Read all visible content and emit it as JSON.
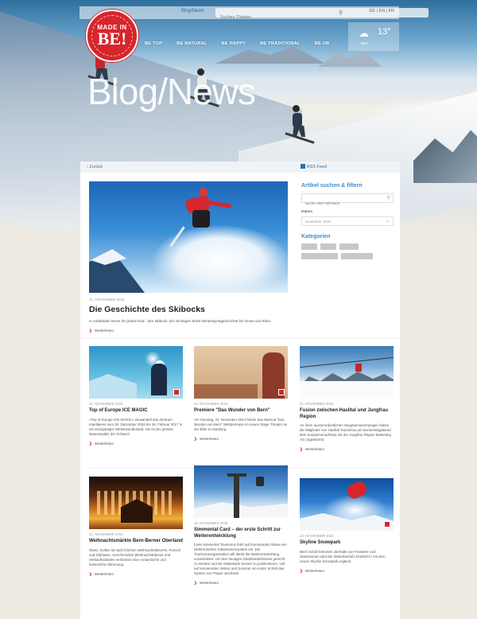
{
  "colors": {
    "accent": "#d7252c",
    "link": "#3d8ed1",
    "page_bg": "#eeeae1"
  },
  "topbar": {
    "blog_link": "Blog/News",
    "search_placeholder": "Suchen Theater",
    "lang": "DE | EN | FR"
  },
  "logo": {
    "made": "MADE IN",
    "be": "BE!"
  },
  "nav": {
    "items": [
      "BE TOP",
      "BE NATURAL",
      "BE HAPPY",
      "BE TRADITIONAL",
      "BE UB"
    ]
  },
  "weather": {
    "icon": "cloud-icon",
    "temp": "13°",
    "label": "Bern"
  },
  "hero": {
    "title": "Blog/News"
  },
  "crumbbar": {
    "back": "‹ Zurück",
    "rss": "RSS Feed"
  },
  "featured": {
    "date": "21. NOVEMBER 2016",
    "title": "Die Geschichte des Skibocks",
    "excerpt": "In Adelboden kennt ihn jedes Kind - den Skibock. Ein wichtiges Stück Wintersportgeschichte für Gross und Klein.",
    "more": "Weiterlesen"
  },
  "sidebar": {
    "filter_title": "Artikel suchen & filtern",
    "search_placeholder": "Suche nach Stichwort",
    "date_label": "Datum",
    "date_value": "November 2016",
    "categories_title": "Kategorien"
  },
  "cards": [
    {
      "date": "22. NOVEMBER 2016",
      "title": "Top of Europe ICE MAGIC",
      "text": "«Top of Europe ICE MAGIC» verwandelt das Zentrum Interlakens vom 20. Dezember 2016 bis 26. Februar 2017 in ein einzigartiges Winterwunderland. Sie ist der grösste Natureisplatz der Schweiz.",
      "more": "Weiterlesen"
    },
    {
      "date": "22. NOVEMBER 2016",
      "title": "Premiere \"Das Wunder von Bern\"",
      "text": "Am Sonntag, 23. November 2014 feierte das Musical \"Das Wunder von Bern\" Weltpremiere im neuen Stage Theater an der Elbe in Hamburg.",
      "more": "Weiterlesen"
    },
    {
      "date": "21. NOVEMBER 2016",
      "title": "Fusion zwischen Haslital und Jungfrau Region",
      "text": "An ihren ausserordentlichen Hauptversammlungen haben die Mitglieder von Haslital Tourismus am Donnerstagabend dem Zusammenschluss mit der Jungfrau Region Marketing AG zugestimmt.",
      "more": "Weiterlesen"
    },
    {
      "date": "21. NOVEMBER 2016",
      "title": "Weihnachtsmärkte Bern-Berner Oberland",
      "text": "Glanz, Duftes ist nach frischen Weihnachtsbrezeln, Punsch und Glühwein. Geschmückte Weihnachtsbäume und Verkaufsständen verbreiten eine romantische und besinnliche Stimmung.",
      "more": "Weiterlesen"
    },
    {
      "date": "19. NOVEMBER 2016",
      "title": "Simmental Card – der erste Schritt zur Weiterentwicklung",
      "text": "Lenk-Simmental Tourismus führt auf kommenden Winter ein elektronisches Gästekartensystem ein. Die Tourismusorganisation will damit die Weiterentwicklung vorantreiben. Um den heutigen Gästebedürfnissen gerecht zu werden und die Gästekarte besser zu positionieren, soll auf kommenden Winter und Sommer ein erster Schritt das System von Papier wechseln.",
      "more": "Weiterlesen"
    },
    {
      "date": "18. NOVEMBER 2016",
      "title": "Skyline Snowpark",
      "text": "Beim Schilt Grimmen oberhalb von Frasterer und Zweisimmen wird der Winterbetrieb 2016/2017 mit dem neuen Skyline Snowpark ergänzt.",
      "more": "Weiterlesen"
    }
  ]
}
